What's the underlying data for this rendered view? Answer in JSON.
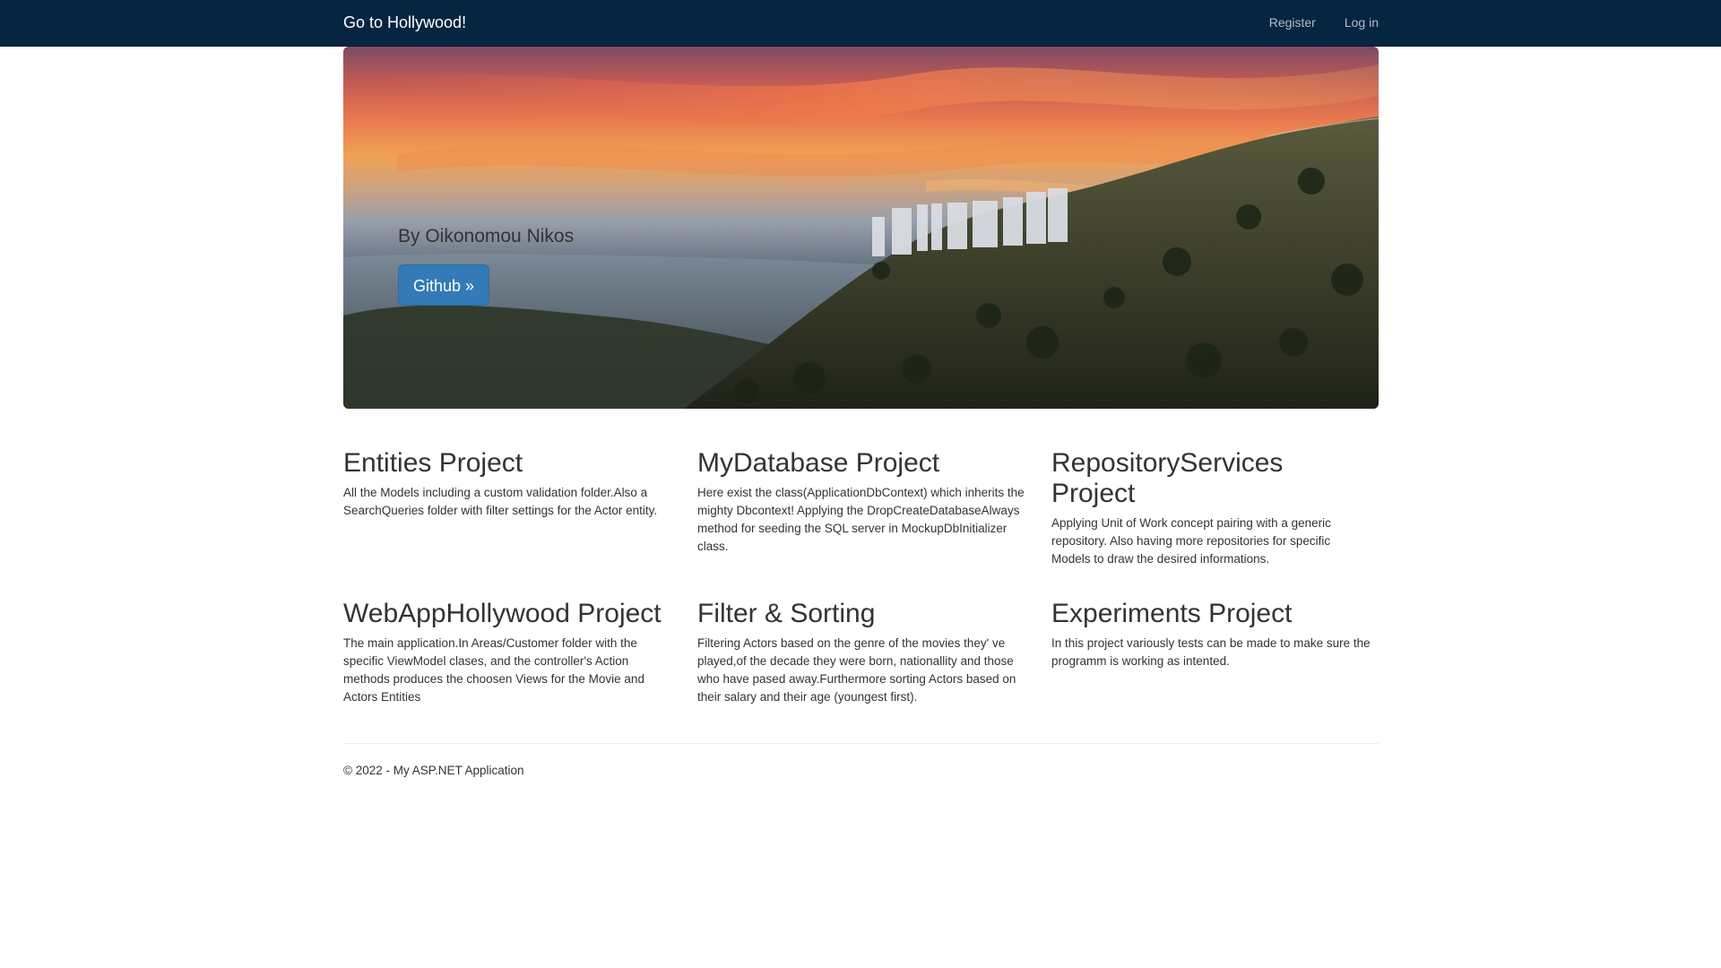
{
  "navbar": {
    "brand": "Go to Hollywood!",
    "register": "Register",
    "login": "Log in",
    "background_color": "#052541"
  },
  "hero": {
    "subtitle": "By Oikonomou Nikos",
    "button_label": "Github »",
    "button_color": "#337ab7",
    "image_description_icon": "hollywood-sign-sunset-image"
  },
  "projects": [
    {
      "title": "Entities Project",
      "text": "All the Models including a custom validation folder.Also a SearchQueries folder with filter settings for the Actor entity."
    },
    {
      "title": "MyDatabase Project",
      "text": "Here exist the class(ApplicationDbContext) which inherits the mighty Dbcontext! Applying the DropCreateDatabaseAlways method for seeding the SQL server in MockupDbInitializer class."
    },
    {
      "title": "RepositoryServices Project",
      "text": "Applying Unit of Work concept pairing with a generic repository. Also having more repositories for specific Models to draw the desired informations."
    },
    {
      "title": "WebAppHollywood Project",
      "text": "The main application.In Areas/Customer folder with the specific ViewModel clases, and the controller's Action methods produces the choosen Views for the Movie and Actors Entities"
    },
    {
      "title": "Filter & Sorting",
      "text": "Filtering Actors based on the genre of the movies they' ve played,of the decade they were born, nationallity and those who have pased away.Furthermore sorting Actors based on their salary and their age (youngest first)."
    },
    {
      "title": "Experiments Project",
      "text": "In this project variously tests can be made to make sure the programm is working as intented."
    }
  ],
  "footer": {
    "text": "© 2022 - My ASP.NET Application"
  }
}
